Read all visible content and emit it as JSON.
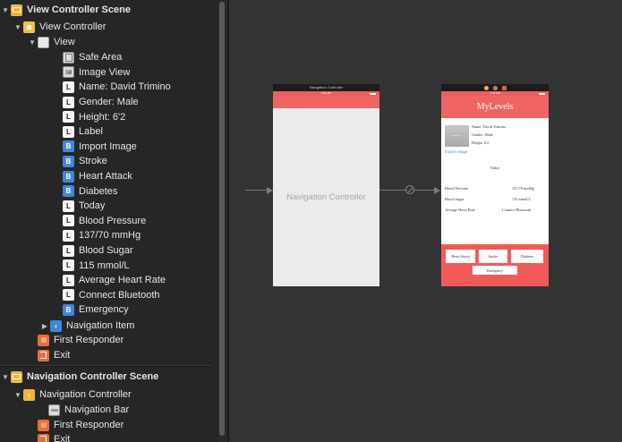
{
  "outline": {
    "scene1": {
      "title": "View Controller Scene",
      "view_controller": "View Controller",
      "view": "View",
      "children": [
        {
          "kind": "safe",
          "label": "Safe Area"
        },
        {
          "kind": "img",
          "label": "Image View"
        },
        {
          "kind": "L",
          "label": "Name: David Trimino"
        },
        {
          "kind": "L",
          "label": "Gender: Male"
        },
        {
          "kind": "L",
          "label": "Height: 6'2"
        },
        {
          "kind": "L",
          "label": "Label"
        },
        {
          "kind": "B",
          "label": "Import Image"
        },
        {
          "kind": "B",
          "label": "Stroke"
        },
        {
          "kind": "B",
          "label": "Heart Attack"
        },
        {
          "kind": "B",
          "label": "Diabetes"
        },
        {
          "kind": "L",
          "label": "Today"
        },
        {
          "kind": "L",
          "label": "Blood Pressure"
        },
        {
          "kind": "L",
          "label": "137/70 mmHg"
        },
        {
          "kind": "L",
          "label": "Blood Sugar"
        },
        {
          "kind": "L",
          "label": "115 mmol/L"
        },
        {
          "kind": "L",
          "label": "Average Heart Rate"
        },
        {
          "kind": "L",
          "label": "Connect Bluetooth"
        },
        {
          "kind": "B",
          "label": "Emergency"
        }
      ],
      "navigation_item": "Navigation Item",
      "first_responder": "First Responder",
      "exit": "Exit"
    },
    "scene2": {
      "title": "Navigation Controller Scene",
      "navigation_controller": "Navigation Controller",
      "navigation_bar": "Navigation Bar",
      "first_responder": "First Responder",
      "exit": "Exit"
    }
  },
  "canvas": {
    "nav_scene": {
      "title": "Navigation Controller",
      "time": "9:41 AM",
      "body_label": "Navigation Controller"
    },
    "vc_scene": {
      "time": "9:41 AM",
      "nav_title": "MyLevels",
      "image_placeholder": "ImageView",
      "name": "Name: David Trimino",
      "gender": "Gender: Male",
      "height": "Height: 6'2",
      "import_image": "Import Image",
      "today": "Today",
      "bp_label": "Blood Pressure",
      "bp_value": "137/70 mmHg",
      "bs_label": "Blood Sugar",
      "bs_value": "115 mmol/L",
      "hr_label": "Average Heart Rate",
      "hr_value": "Connect Bluetooth",
      "btn_heart": "Heart Attack",
      "btn_stroke": "Stroke",
      "btn_diabetes": "Diabetes",
      "btn_emergency": "Emergency"
    }
  }
}
